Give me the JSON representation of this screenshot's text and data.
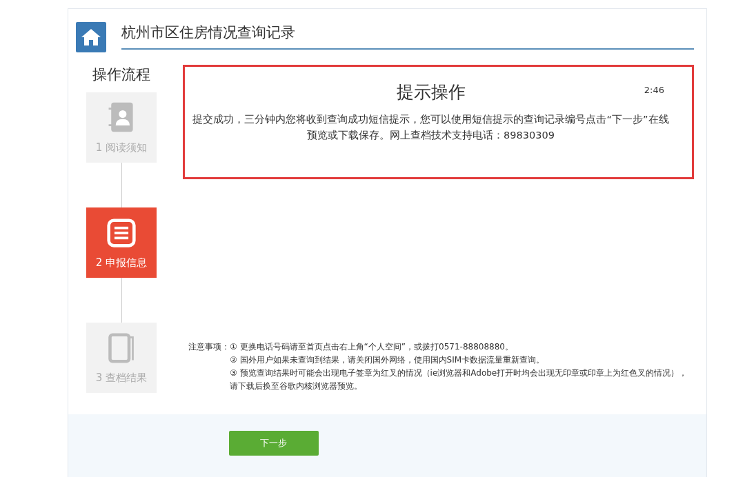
{
  "header": {
    "title": "杭州市区住房情况查询记录"
  },
  "process": {
    "title": "操作流程",
    "steps": [
      {
        "number": "1",
        "label": "阅读须知",
        "kind": "contact",
        "selected": false
      },
      {
        "number": "2",
        "label": "申报信息",
        "kind": "list",
        "selected": true
      },
      {
        "number": "3",
        "label": "查档结果",
        "kind": "book",
        "selected": false
      }
    ]
  },
  "notice": {
    "title": "提示操作",
    "timer": "2:46",
    "message": "提交成功，三分钟内您将收到查询成功短信提示，您可以使用短信提示的查询记录编号点击“下一步”在线预览或下载保存。网上查档技术支持电话：89830309"
  },
  "notes": {
    "label": "注意事项：",
    "items": [
      "① 更换电话号码请至首页点击右上角“个人空间”，或拨打0571-88808880。",
      "② 国外用户如果未查询到结果，请关闭国外网络，使用国内SIM卡数据流量重新查询。",
      "③ 预览查询结果时可能会出现电子签章为红叉的情况（ie浏览器和Adobe打开时均会出现无印章或印章上为红色叉的情况），请下载后换至谷歌内核浏览器预览。"
    ]
  },
  "next_button": "下一步"
}
